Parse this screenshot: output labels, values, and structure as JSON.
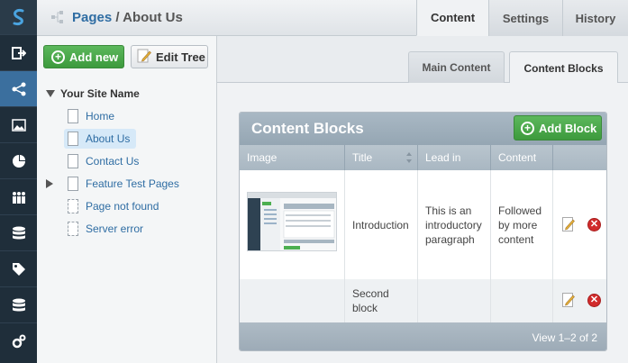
{
  "nav": {
    "items": [
      {
        "icon": "logo-icon"
      },
      {
        "icon": "logout-icon"
      },
      {
        "icon": "sitetree-icon"
      },
      {
        "icon": "image-icon"
      },
      {
        "icon": "reports-icon"
      },
      {
        "icon": "users-icon"
      },
      {
        "icon": "database-icon"
      },
      {
        "icon": "tag-icon"
      },
      {
        "icon": "database-icon"
      },
      {
        "icon": "settings-icon"
      }
    ]
  },
  "header": {
    "breadcrumb_link": "Pages",
    "breadcrumb_sep": "/",
    "breadcrumb_current": "About Us",
    "tabs": [
      "Content",
      "Settings",
      "History"
    ]
  },
  "tree": {
    "add_new": "Add new",
    "edit_tree": "Edit Tree",
    "root": "Your Site Name",
    "nodes": [
      "Home",
      "About Us",
      "Contact Us",
      "Feature Test Pages",
      "Page not found",
      "Server error"
    ]
  },
  "subtabs": [
    "Main Content",
    "Content Blocks"
  ],
  "grid": {
    "title": "Content Blocks",
    "add_block": "Add Block",
    "columns": [
      "Image",
      "Title",
      "Lead in",
      "Content"
    ],
    "rows": [
      {
        "title": "Introduction",
        "lead_in": "This is an introductory paragraph",
        "content": "Followed by more content"
      },
      {
        "title": "Second block",
        "lead_in": "",
        "content": ""
      }
    ],
    "pager": "View 1–2 of 2"
  },
  "colors": {
    "accent_blue": "#2f6da3",
    "green": "#4caf50",
    "delete_red": "#d12b2b"
  }
}
